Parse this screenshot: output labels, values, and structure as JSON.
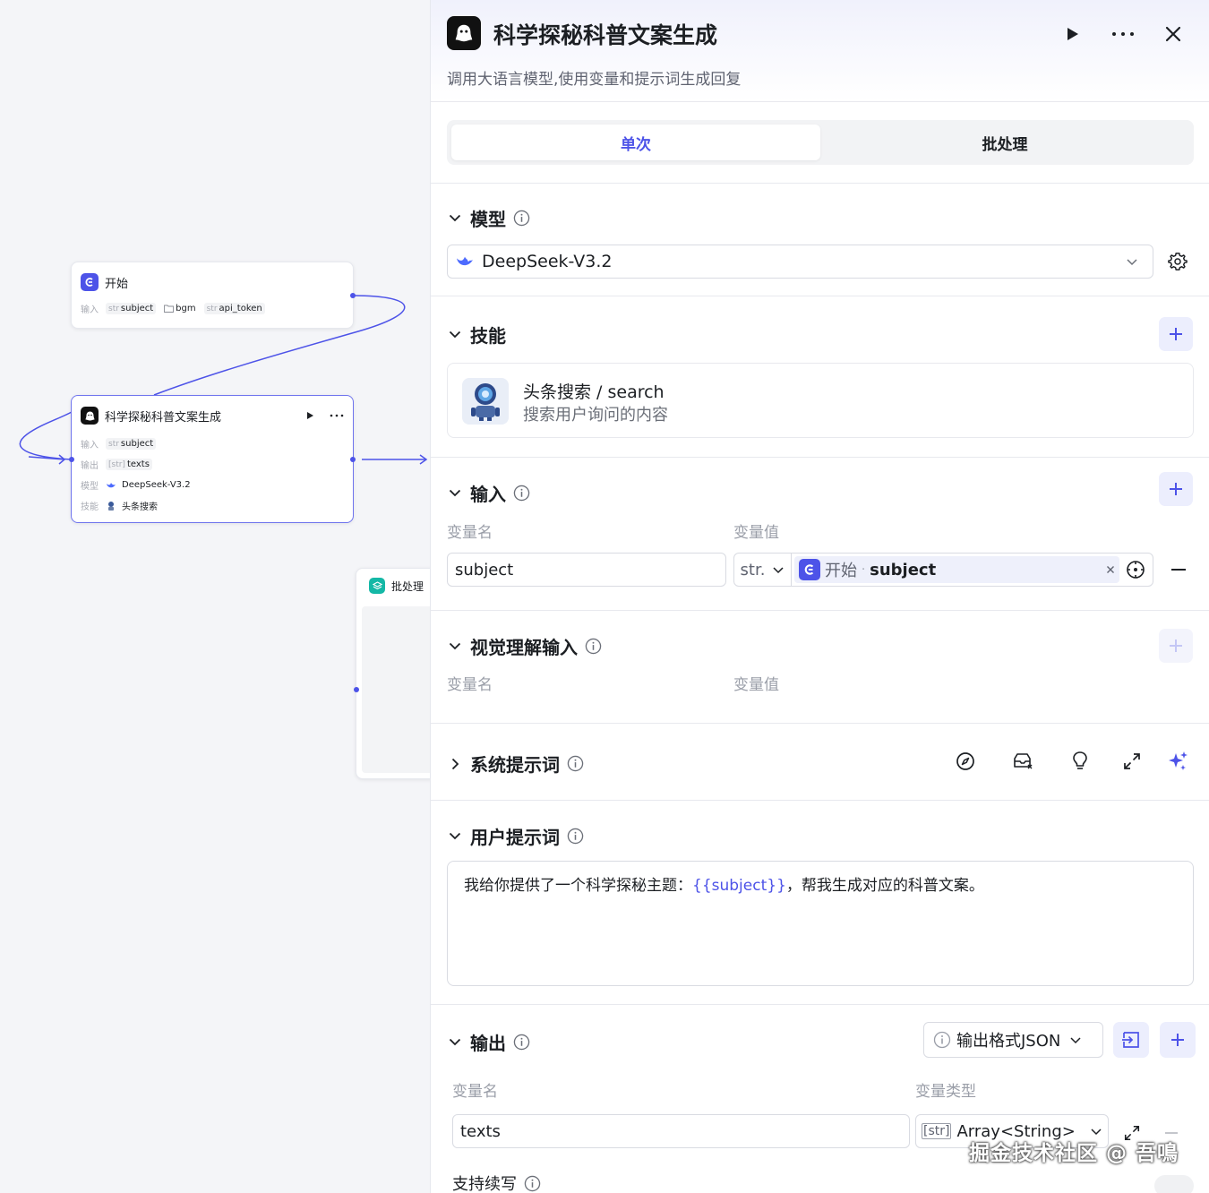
{
  "canvas": {
    "start_node": {
      "title": "开始",
      "row_key": "输入",
      "params": [
        {
          "type": "str",
          "name": "subject"
        },
        {
          "type": "folder",
          "name": "bgm"
        },
        {
          "type": "str",
          "name": "api_token"
        }
      ]
    },
    "llm_node": {
      "title": "科学探秘科普文案生成",
      "rows": [
        {
          "key": "输入",
          "type": "str",
          "value": "subject"
        },
        {
          "key": "输出",
          "type": "[str]",
          "value": "texts"
        },
        {
          "key": "模型",
          "value": "DeepSeek-V3.2"
        },
        {
          "key": "技能",
          "value": "头条搜索"
        }
      ]
    },
    "batch_node": {
      "title": "批处理"
    }
  },
  "panel": {
    "title": "科学探秘科普文案生成",
    "description": "调用大语言模型,使用变量和提示词生成回复",
    "tabs": [
      {
        "label": "单次",
        "active": true
      },
      {
        "label": "批处理",
        "active": false
      }
    ],
    "model": {
      "section_title": "模型",
      "selected": "DeepSeek-V3.2"
    },
    "skills": {
      "section_title": "技能",
      "items": [
        {
          "name": "头条搜索 / search",
          "desc": "搜索用户询问的内容"
        }
      ]
    },
    "inputs": {
      "section_title": "输入",
      "col_name": "变量名",
      "col_value": "变量值",
      "rows": [
        {
          "name": "subject",
          "type": "str.",
          "ref_node": "开始",
          "ref_sep": "·",
          "ref_var": "subject"
        }
      ]
    },
    "vision_inputs": {
      "section_title": "视觉理解输入",
      "col_name": "变量名",
      "col_value": "变量值"
    },
    "system_prompt": {
      "section_title": "系统提示词"
    },
    "user_prompt": {
      "section_title": "用户提示词",
      "text_before": "我给你提供了一个科学探秘主题：",
      "variable": "{{subject}}",
      "text_after": "，帮我生成对应的科普文案。"
    },
    "output": {
      "section_title": "输出",
      "format_label": "输出格式JSON",
      "col_name": "变量名",
      "col_type": "变量类型",
      "rows": [
        {
          "name": "texts",
          "type_tag": "[str]",
          "type": "Array<String>"
        }
      ],
      "continue_label": "支持续写"
    }
  },
  "watermark": "掘金技术社区 @ 吾鳴",
  "colors": {
    "accent": "#4d53e8",
    "accent_bg": "#eceefd",
    "text": "#1c1f23",
    "muted": "#9a9ea8",
    "border": "#d9dbe2"
  }
}
